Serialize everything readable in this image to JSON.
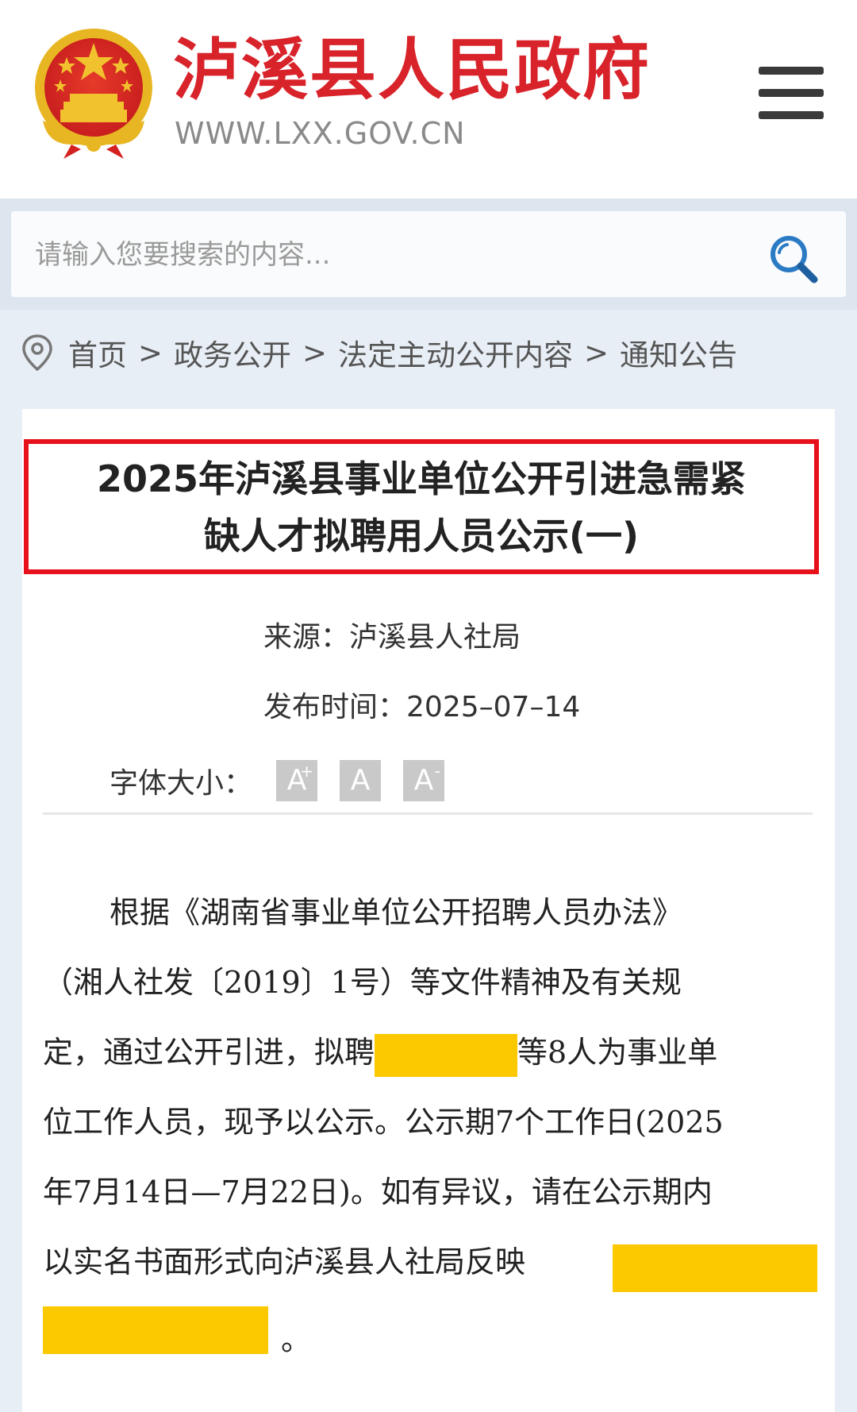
{
  "header": {
    "site_name": "泸溪县人民政府",
    "site_domain": "WWW.LXX.GOV.CN"
  },
  "search": {
    "placeholder": "请输入您要搜索的内容..."
  },
  "breadcrumb": {
    "items": [
      "首页",
      "政务公开",
      "法定主动公开内容",
      "通知公告"
    ],
    "separator": ">"
  },
  "article": {
    "title_lines": [
      "2025年泸溪县事业单位公开引进急需紧",
      "缺人才拟聘用人员公示(一)"
    ],
    "source_label": "来源：",
    "source_value": "泸溪县人社局",
    "date_label": "发布时间：",
    "date_value": "2025–07–14",
    "font_size_label": "字体大小：",
    "font_size_buttons": {
      "increase": "A",
      "increase_mark": "+",
      "normal": "A",
      "decrease": "A",
      "decrease_mark": "-"
    },
    "paragraph_lines": [
      "根据《湖南省事业单位公开招聘人员办法》",
      "（湘人社发〔2019〕1号）等文件精神及有关规",
      "定，通过公开引进，拟聘",
      "等8人为事业单",
      "位工作人员，现予以公示。公示期7个工作日(2025",
      "年7月14日—7月22日)。如有异议，请在公示期内",
      "以实名书面形式向泸溪县人社局反映",
      "。"
    ]
  },
  "colors": {
    "brand_red": "#d8232a",
    "title_border": "#e6111b",
    "redaction": "#fcc800",
    "search_icon": "#2b7bc4"
  },
  "icons": {
    "emblem": "national-emblem",
    "menu": "hamburger-menu-icon",
    "search": "search-icon",
    "location": "location-pin-icon"
  }
}
